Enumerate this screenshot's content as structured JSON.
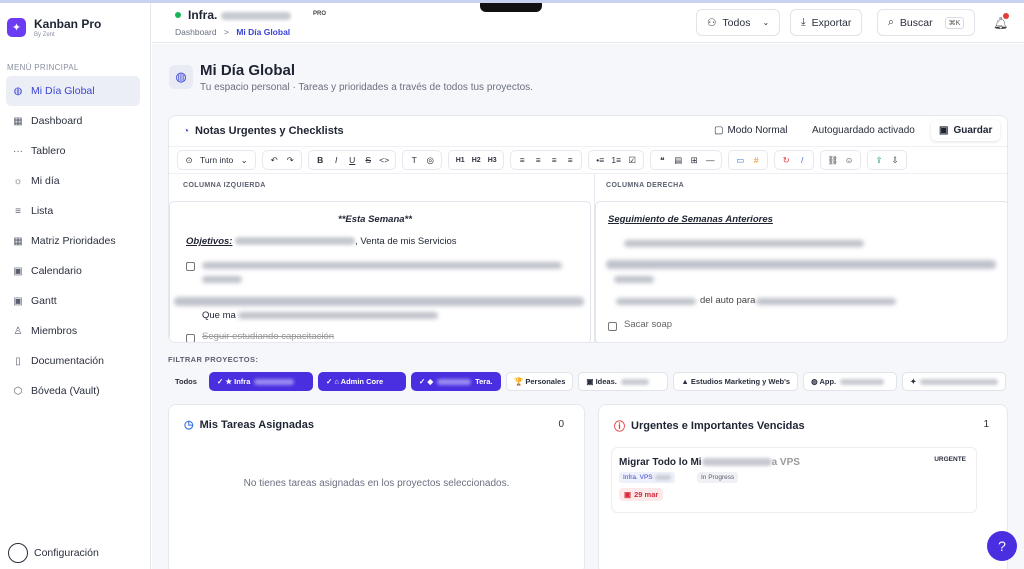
{
  "sidebar": {
    "brand_name": "Kanban Pro",
    "brand_sub": "By Zent",
    "section": "MENÚ PRINCIPAL",
    "items": [
      {
        "label": "Mi Día Global",
        "icon": "globe-icon"
      },
      {
        "label": "Dashboard",
        "icon": "grid-icon"
      },
      {
        "label": "Tablero",
        "icon": "dots-icon"
      },
      {
        "label": "Mi día",
        "icon": "sun-icon"
      },
      {
        "label": "Lista",
        "icon": "list-icon"
      },
      {
        "label": "Matriz Prioridades",
        "icon": "matrix-icon"
      },
      {
        "label": "Calendario",
        "icon": "calendar-icon"
      },
      {
        "label": "Gantt",
        "icon": "gantt-icon"
      },
      {
        "label": "Miembros",
        "icon": "user-icon"
      },
      {
        "label": "Documentación",
        "icon": "doc-icon"
      },
      {
        "label": "Bóveda (Vault)",
        "icon": "shield-icon"
      }
    ],
    "footer": "Configuración"
  },
  "header": {
    "workspace": "Infra.",
    "badge": "PRO",
    "breadcrumb_root": "Dashboard",
    "breadcrumb_sep": ">",
    "breadcrumb_current": "Mi Día Global",
    "filter_btn": "Todos",
    "export_btn": "Exportar",
    "search_btn": "Buscar",
    "search_kbd": "⌘K"
  },
  "page": {
    "title": "Mi Día Global",
    "subtitle": "Tu espacio personal · Tareas y prioridades a través de todos tus proyectos."
  },
  "notes": {
    "title": "Notas Urgentes y Checklists",
    "mode": "Modo Normal",
    "autosave": "Autoguardado activado",
    "save": "Guardar",
    "turn_into": "Turn into",
    "toolbar": {
      "g2": [
        "↶",
        "↷"
      ],
      "g3": [
        "B",
        "I",
        "U",
        "S",
        "<>"
      ],
      "g4": [
        "T",
        "◎"
      ],
      "g5": [
        "H1",
        "H2",
        "H3"
      ],
      "g6": [
        "≡",
        "≡",
        "≡",
        "≡"
      ],
      "g7": [
        "•≡",
        "1≡",
        "☑"
      ],
      "g8": [
        "❝",
        "▤",
        "⊞",
        "—"
      ],
      "g9": [
        "▭",
        "#"
      ],
      "g10": [
        "↻",
        "/"
      ],
      "g11": [
        "⛓",
        "☺"
      ],
      "g12": [
        "⇪",
        "⇩"
      ]
    },
    "left_header": "COLUMNA IZQUIERDA",
    "right_header": "COLUMNA DERECHA",
    "left_heading": "**Esta Semana**",
    "left_objetivos": "Objetivos:",
    "left_objetivos_tail": ", Venta de mis Servicios",
    "left_line_que": "Que ma",
    "left_line_seguir": "Seguir estudiando capacitación",
    "right_heading": "Seguimiento de Semanas Anteriores",
    "right_item_sacar": "Sacar soap",
    "right_line_auto": "del auto para"
  },
  "filters": {
    "label": "FILTRAR PROYECTOS:",
    "chips": [
      {
        "label": "Todos",
        "on": false
      },
      {
        "label": "✓ ★ Infra",
        "on": true
      },
      {
        "label": "✓ ⌂ Admin Core",
        "on": true
      },
      {
        "label": "✓ ◆ Tera.",
        "on": true
      },
      {
        "label": "🏆 Personales",
        "on": false
      },
      {
        "label": "▣ Ideas.",
        "on": false
      },
      {
        "label": "▲ Estudios Marketing y Web's",
        "on": false
      },
      {
        "label": "◍ App.",
        "on": false
      },
      {
        "label": "✦",
        "on": false
      }
    ]
  },
  "assigned": {
    "title": "Mis Tareas Asignadas",
    "count": "0",
    "empty": "No tienes tareas asignadas en los proyectos seleccionados."
  },
  "urgent": {
    "title": "Urgentes e Importantes Vencidas",
    "count": "1",
    "task_title": "Migrar Todo lo Mi",
    "task_title_tail": "a VPS",
    "flag": "URGENTE",
    "tag_project": "Infra. VPS",
    "tag_status": "In Progress",
    "due": "29 mar"
  },
  "colors": {
    "accent": "#3b45d6",
    "chip_active": "#4a2fe0",
    "urgent_red": "#d42a3a"
  }
}
